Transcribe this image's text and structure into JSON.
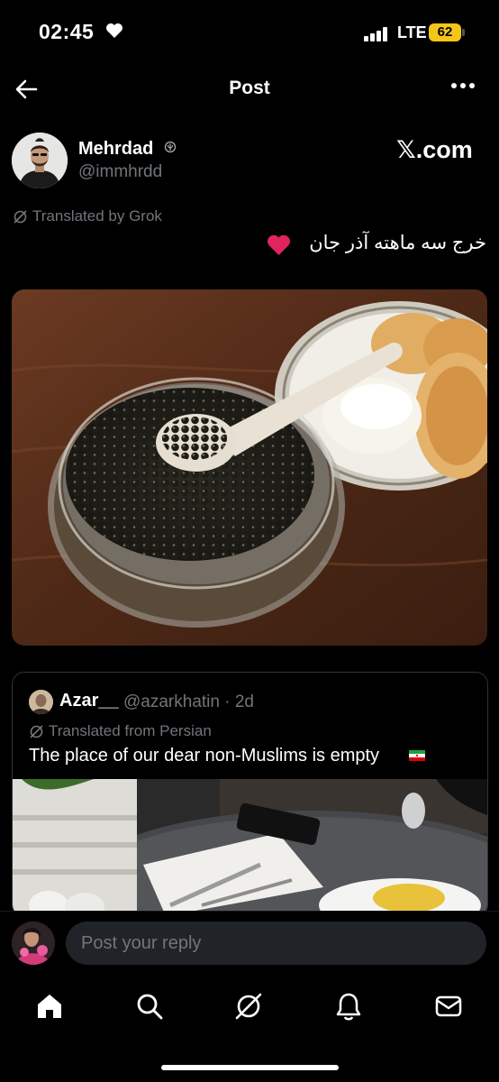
{
  "status": {
    "time": "02:45",
    "network": "LTE",
    "battery": "62"
  },
  "header": {
    "title": "Post"
  },
  "author": {
    "name": "Mehrdad",
    "handle": "@immhrdd",
    "watermark": "𝕏.com"
  },
  "post": {
    "translated_label": "Translated by Grok",
    "text": "خرج سه ماهته آذر جان"
  },
  "quote": {
    "name": "Azar__",
    "handle_time": "@azarkhatin · 2d",
    "translated_label": "Translated from Persian",
    "text": "The place of our dear non-Muslims is empty"
  },
  "reply": {
    "placeholder": "Post your reply"
  },
  "tabs": [
    "home-icon",
    "search-icon",
    "grok-icon",
    "notifications-icon",
    "messages-icon"
  ],
  "colors": {
    "background": "#000000",
    "muted": "#71767b",
    "battery": "#f5c518",
    "heart": "#e0245e"
  }
}
